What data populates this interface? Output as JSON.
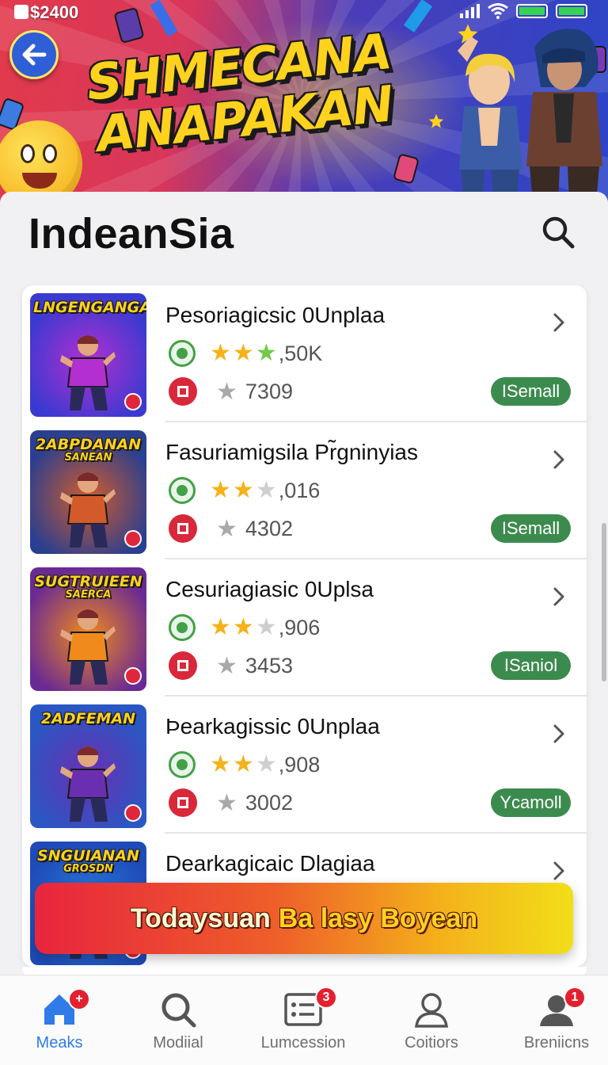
{
  "status_bar": {
    "balance": "$2400"
  },
  "banner": {
    "headline_line1": "SHMECANA",
    "headline_line2": "ANAPAKAN"
  },
  "header": {
    "title": "IndeanSia"
  },
  "games": [
    {
      "thumb_title": "LNGENGANGAN",
      "thumb_subtitle": "",
      "name": "Pesoriagicsic 0Unplaa",
      "rating_count": ",50K",
      "stars": 2.5,
      "plays": "7309",
      "action": "ISemall",
      "thumb_colors": [
        "#3a3ad0",
        "#b42fd0"
      ]
    },
    {
      "thumb_title": "2ABPDANAN",
      "thumb_subtitle": "SANEAN",
      "name": "Fasuriamigsila Pr̃gninyias",
      "rating_count": ",016",
      "stars": 2,
      "plays": "4302",
      "action": "ISemall",
      "thumb_colors": [
        "#2a3f8f",
        "#d35b2b"
      ]
    },
    {
      "thumb_title": "SUGTRUIEEN",
      "thumb_subtitle": "SAERCA",
      "name": "Cesuriagiasic 0Uplsa",
      "rating_count": ",906",
      "stars": 2,
      "plays": "3453",
      "action": "ISaniol",
      "thumb_colors": [
        "#6b2a93",
        "#f08a1c"
      ]
    },
    {
      "thumb_title": "2ADFEMAN",
      "thumb_subtitle": "",
      "name": "Þearkagissic 0Unplaa",
      "rating_count": ",908",
      "stars": 2,
      "plays": "3002",
      "action": "Ycamoll",
      "thumb_colors": [
        "#2b57c4",
        "#6a2fb1"
      ]
    },
    {
      "thumb_title": "SNGUIANAN",
      "thumb_subtitle": "GROSDN",
      "name": "Dearkagicaic Dlagiaa",
      "rating_count": "",
      "stars": 0,
      "plays": "",
      "action": "",
      "thumb_colors": [
        "#1f4bb8",
        "#2a7fe0"
      ]
    }
  ],
  "promo_toast": {
    "text_white": "Todaysuan",
    "text_gold": "Ba lasy Boyean"
  },
  "bottom_nav": [
    {
      "label": "Meaks",
      "icon": "home-icon",
      "badge": "+",
      "active": true
    },
    {
      "label": "Modiial",
      "icon": "search-icon",
      "badge": "",
      "active": false
    },
    {
      "label": "Lumcession",
      "icon": "list-icon",
      "badge": "3",
      "active": false
    },
    {
      "label": "Coitiors",
      "icon": "person-icon",
      "badge": "",
      "active": false
    },
    {
      "label": "Breniicns",
      "icon": "profile-icon",
      "badge": "1",
      "active": false
    }
  ],
  "colors": {
    "accent": "#2f7be8",
    "install_pill": "#3c8b4e",
    "badge_red": "#e3202f"
  }
}
